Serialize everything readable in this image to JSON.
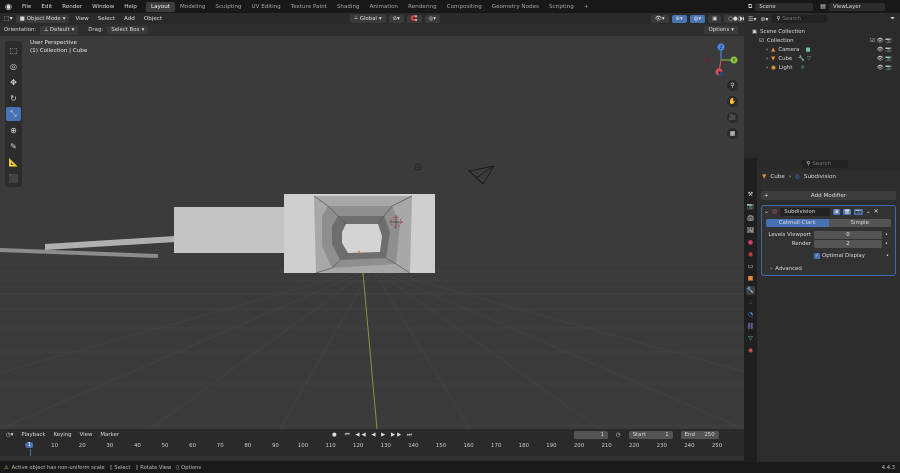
{
  "topbar": {
    "menus": [
      "File",
      "Edit",
      "Render",
      "Window",
      "Help"
    ],
    "workspaces": [
      "Layout",
      "Modeling",
      "Sculpting",
      "UV Editing",
      "Texture Paint",
      "Shading",
      "Animation",
      "Rendering",
      "Compositing",
      "Geometry Nodes",
      "Scripting"
    ],
    "add_tab": "+",
    "scene": "Scene",
    "view_layer": "ViewLayer"
  },
  "viewport_header": {
    "mode": "Object Mode",
    "menus": [
      "View",
      "Select",
      "Add",
      "Object"
    ],
    "transform": "Global",
    "options": "Options"
  },
  "tool_settings": {
    "orientation_label": "Orientation:",
    "orientation": "Default",
    "drag_label": "Drag:",
    "drag": "Select Box"
  },
  "viewport": {
    "view_name": "User Perspective",
    "collection_info": "(1) Collection | Cube",
    "gizmo": {
      "x": "X",
      "y": "Y",
      "z": "Z"
    }
  },
  "outliner": {
    "search_placeholder": "Search",
    "root": "Scene Collection",
    "collection": "Collection",
    "items": [
      {
        "name": "Camera",
        "icon": "camera-icon",
        "color": "#e08a3c"
      },
      {
        "name": "Cube",
        "icon": "mesh-icon",
        "color": "#e08a3c"
      },
      {
        "name": "Light",
        "icon": "light-icon",
        "color": "#e08a3c"
      }
    ]
  },
  "properties": {
    "search_placeholder": "Search",
    "breadcrumb_object": "Cube",
    "breadcrumb_modifier": "Subdivision",
    "add_modifier": "Add Modifier",
    "modifier": {
      "name": "Subdivision",
      "type_a": "Catmull-Clark",
      "type_b": "Simple",
      "levels_viewport_label": "Levels Viewport",
      "levels_viewport": "0",
      "render_label": "Render",
      "render": "2",
      "optimal_display": "Optimal Display",
      "advanced": "Advanced"
    }
  },
  "timeline": {
    "menus": [
      "Playback",
      "Keying",
      "View",
      "Marker"
    ],
    "current_frame": "1",
    "start_label": "Start",
    "start": "1",
    "end_label": "End",
    "end": "250",
    "ticks": [
      "0",
      "10",
      "20",
      "30",
      "40",
      "50",
      "60",
      "70",
      "80",
      "90",
      "100",
      "110",
      "120",
      "130",
      "140",
      "150",
      "160",
      "170",
      "180",
      "190",
      "200",
      "210",
      "220",
      "230",
      "240",
      "250"
    ],
    "playhead": "1"
  },
  "statusbar": {
    "warning": "Active object has non-uniform scale",
    "select": "Select",
    "rotate_view": "Rotate View",
    "options": "Options",
    "version": "4.4.3"
  },
  "colors": {
    "accent": "#4772b3",
    "object_orange": "#e08a3c",
    "x_axis": "#e4505a",
    "y_axis": "#8cc63f",
    "z_axis": "#4b8ef0"
  }
}
